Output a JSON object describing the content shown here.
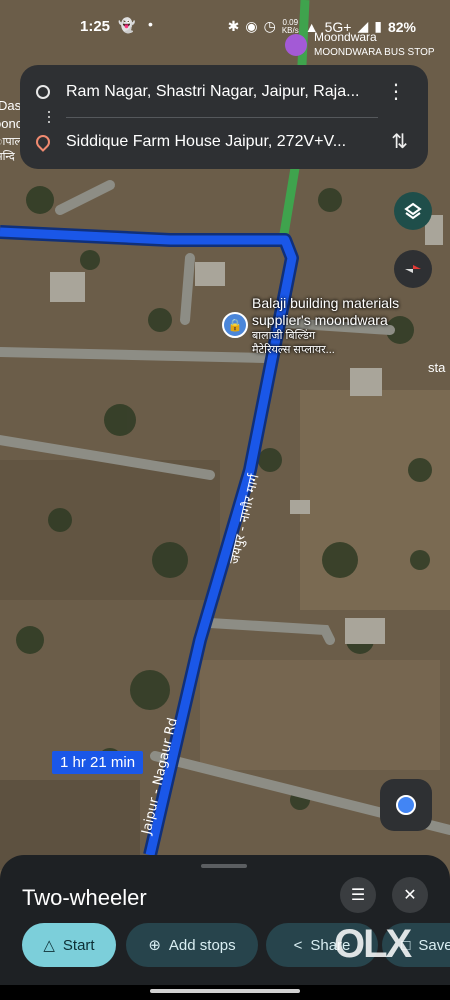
{
  "status_bar": {
    "time": "1:25",
    "speed_top": "0.09",
    "speed_unit": "KB/s",
    "network": "5G+",
    "battery": "82%"
  },
  "directions": {
    "origin": "Ram Nagar, Shastri Nagar, Jaipur, Raja...",
    "destination": "Siddique Farm House Jaipur, 272V+V..."
  },
  "map": {
    "top_place_name": "Moondwara",
    "top_place_sub": "MOONDWARA BUS STOP",
    "left_labels": [
      "Das",
      "oonc",
      "ापाल",
      "मन्दि"
    ],
    "poi_name_line1": "Balaji building materials",
    "poi_name_line2": "supplier's moondwara",
    "poi_hindi_line1": "बालाजी बिल्डिंग",
    "poi_hindi_line2": "मैटेरियल्स सप्लायर...",
    "road_label_en": "Jaipur - Nagaur Rd",
    "road_label_hi": "जयपुर - नागौर मार्ग",
    "right_label": "sta",
    "route_time": "1 hr 21 min"
  },
  "bottom_sheet": {
    "mode_title": "Two-wheeler",
    "start_label": "Start",
    "add_stops_label": "Add stops",
    "share_label": "Share",
    "save_label": "Save"
  },
  "watermark": "OLX",
  "colors": {
    "route": "#1a57e8",
    "sheet_bg": "#1e2124",
    "start_button": "#7ccfda",
    "secondary_button": "#27444c"
  }
}
